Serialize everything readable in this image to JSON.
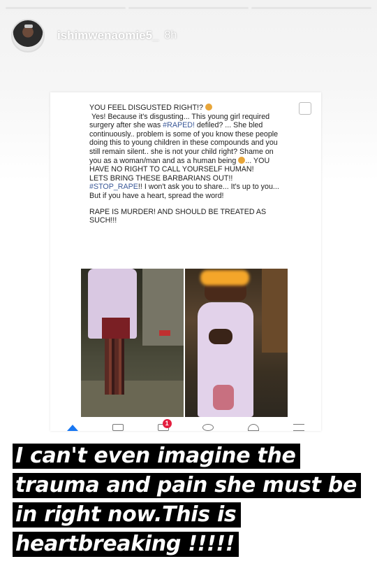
{
  "story": {
    "progress_segments": 3,
    "header": {
      "username": "ishimwenaomie5_",
      "time": "8h"
    },
    "post": {
      "paragraph1": [
        "YOU FEEL DISGUSTED RIGHT!?",
        "Yes! Because it's disgusting... This young girl required surgery after she was",
        "#RAPED!",
        "defiled? ... She bled continuously.. problem is some of you know these people doing this to young children in these compounds and you still remain silent.. she is not your child right? Shame on you as a woman/man and as a human being",
        "... YOU HAVE NO RIGHT TO CALL YOURSELF HUMAN!",
        "LETS BRING THESE BARBARIANS OUT!!",
        "#STOP_RAPE",
        "!! I won't ask you to share... It's up to you... But if you have a heart, spread the word!"
      ],
      "paragraph2": "RAPE IS MURDER! AND SHOULD BE TREATED AS SUCH!!!"
    },
    "navbar": {
      "marketplace_badge": "1"
    },
    "caption": [
      "I can't even imagine the",
      "trauma and pain she must be",
      "in right now.This is",
      "heartbreaking !!!!!"
    ],
    "colors": {
      "caption_bg": "#000000",
      "caption_text": "#ffffff",
      "hashtag": "#3b5998",
      "fb_blue": "#1877f2",
      "badge_red": "#e41e3f"
    }
  }
}
